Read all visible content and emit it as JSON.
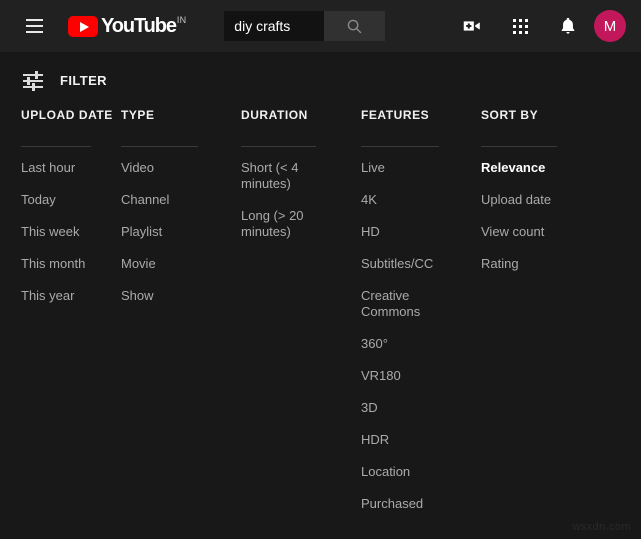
{
  "masthead": {
    "menu_icon": "hamburger-icon",
    "logo_text": "YouTube",
    "logo_country": "IN",
    "search": {
      "value": "diy crafts",
      "placeholder": "Search",
      "button_icon": "search-icon"
    },
    "create_icon": "video-camera-plus-icon",
    "apps_icon": "apps-grid-icon",
    "notifications_icon": "bell-icon",
    "avatar_letter": "M",
    "avatar_color": "#c2185b",
    "logo_color": "#ff0000"
  },
  "filter_bar": {
    "icon": "filter-sliders-icon",
    "label": "FILTER"
  },
  "panel": {
    "columns": [
      {
        "key": "upload_date",
        "header": "UPLOAD DATE",
        "items": [
          {
            "label": "Last hour",
            "selected": false
          },
          {
            "label": "Today",
            "selected": false
          },
          {
            "label": "This week",
            "selected": false
          },
          {
            "label": "This month",
            "selected": false
          },
          {
            "label": "This year",
            "selected": false
          }
        ]
      },
      {
        "key": "type",
        "header": "TYPE",
        "items": [
          {
            "label": "Video",
            "selected": false
          },
          {
            "label": "Channel",
            "selected": false
          },
          {
            "label": "Playlist",
            "selected": false
          },
          {
            "label": "Movie",
            "selected": false
          },
          {
            "label": "Show",
            "selected": false
          }
        ]
      },
      {
        "key": "duration",
        "header": "DURATION",
        "items": [
          {
            "label": "Short (< 4 minutes)",
            "selected": false
          },
          {
            "label": "Long (> 20 minutes)",
            "selected": false
          }
        ]
      },
      {
        "key": "features",
        "header": "FEATURES",
        "items": [
          {
            "label": "Live",
            "selected": false
          },
          {
            "label": "4K",
            "selected": false
          },
          {
            "label": "HD",
            "selected": false
          },
          {
            "label": "Subtitles/CC",
            "selected": false
          },
          {
            "label": "Creative Commons",
            "selected": false
          },
          {
            "label": "360°",
            "selected": false
          },
          {
            "label": "VR180",
            "selected": false
          },
          {
            "label": "3D",
            "selected": false
          },
          {
            "label": "HDR",
            "selected": false
          },
          {
            "label": "Location",
            "selected": false
          },
          {
            "label": "Purchased",
            "selected": false
          }
        ]
      },
      {
        "key": "sort_by",
        "header": "SORT BY",
        "items": [
          {
            "label": "Relevance",
            "selected": true
          },
          {
            "label": "Upload date",
            "selected": false
          },
          {
            "label": "View count",
            "selected": false
          },
          {
            "label": "Rating",
            "selected": false
          }
        ]
      }
    ]
  },
  "watermark": "wsxdn.com"
}
